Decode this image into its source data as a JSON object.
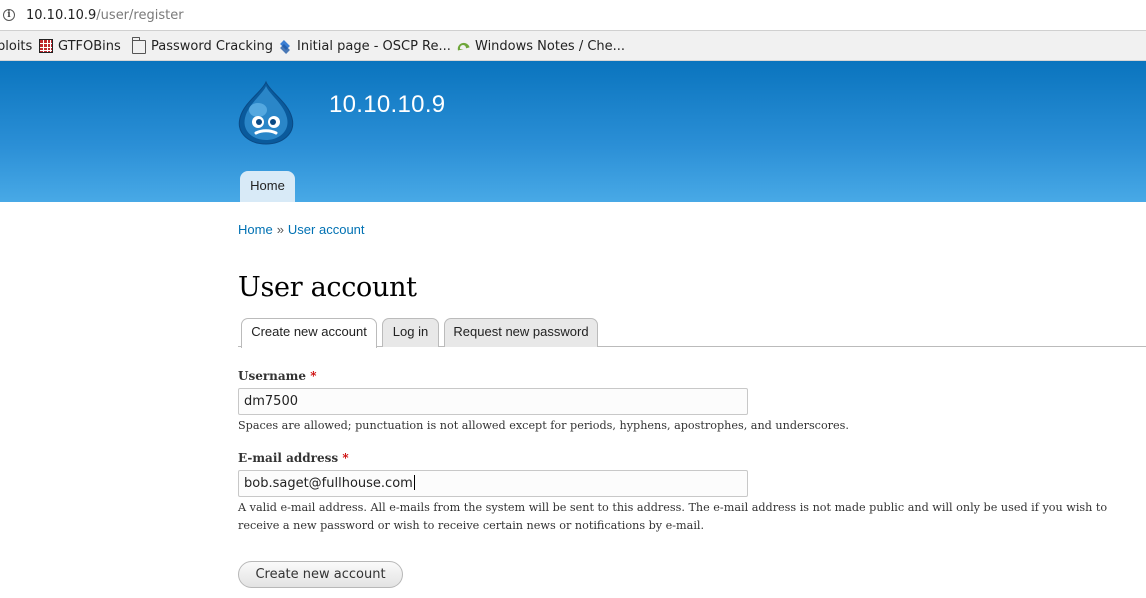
{
  "browser": {
    "url_host": "10.10.10.9",
    "url_path": "/user/register",
    "bookmarks": [
      {
        "label": "ploits",
        "icon": "none"
      },
      {
        "label": "GTFOBins",
        "icon": "grid-icon"
      },
      {
        "label": "Password Cracking",
        "icon": "folder-icon"
      },
      {
        "label": "Initial page - OSCP Re...",
        "icon": "layers-icon"
      },
      {
        "label": "Windows Notes / Che...",
        "icon": "leaf-icon"
      }
    ]
  },
  "header": {
    "site_name": "10.10.10.9",
    "nav_home": "Home",
    "colors": {
      "top": "#0a74be",
      "bottom": "#48a9e6"
    }
  },
  "breadcrumb": {
    "home": "Home",
    "separator": "»",
    "current": "User account"
  },
  "page": {
    "title": "User account",
    "tabs": [
      {
        "label": "Create new account",
        "active": true
      },
      {
        "label": "Log in",
        "active": false
      },
      {
        "label": "Request new password",
        "active": false
      }
    ]
  },
  "form": {
    "username": {
      "label": "Username",
      "required_mark": "*",
      "value": "dm7500",
      "description": "Spaces are allowed; punctuation is not allowed except for periods, hyphens, apostrophes, and underscores."
    },
    "email": {
      "label": "E-mail address",
      "required_mark": "*",
      "value": "bob.saget@fullhouse.com",
      "description": "A valid e-mail address. All e-mails from the system will be sent to this address. The e-mail address is not made public and will only be used if you wish to receive a new password or wish to receive certain news or notifications by e-mail."
    },
    "submit_label": "Create new account"
  }
}
